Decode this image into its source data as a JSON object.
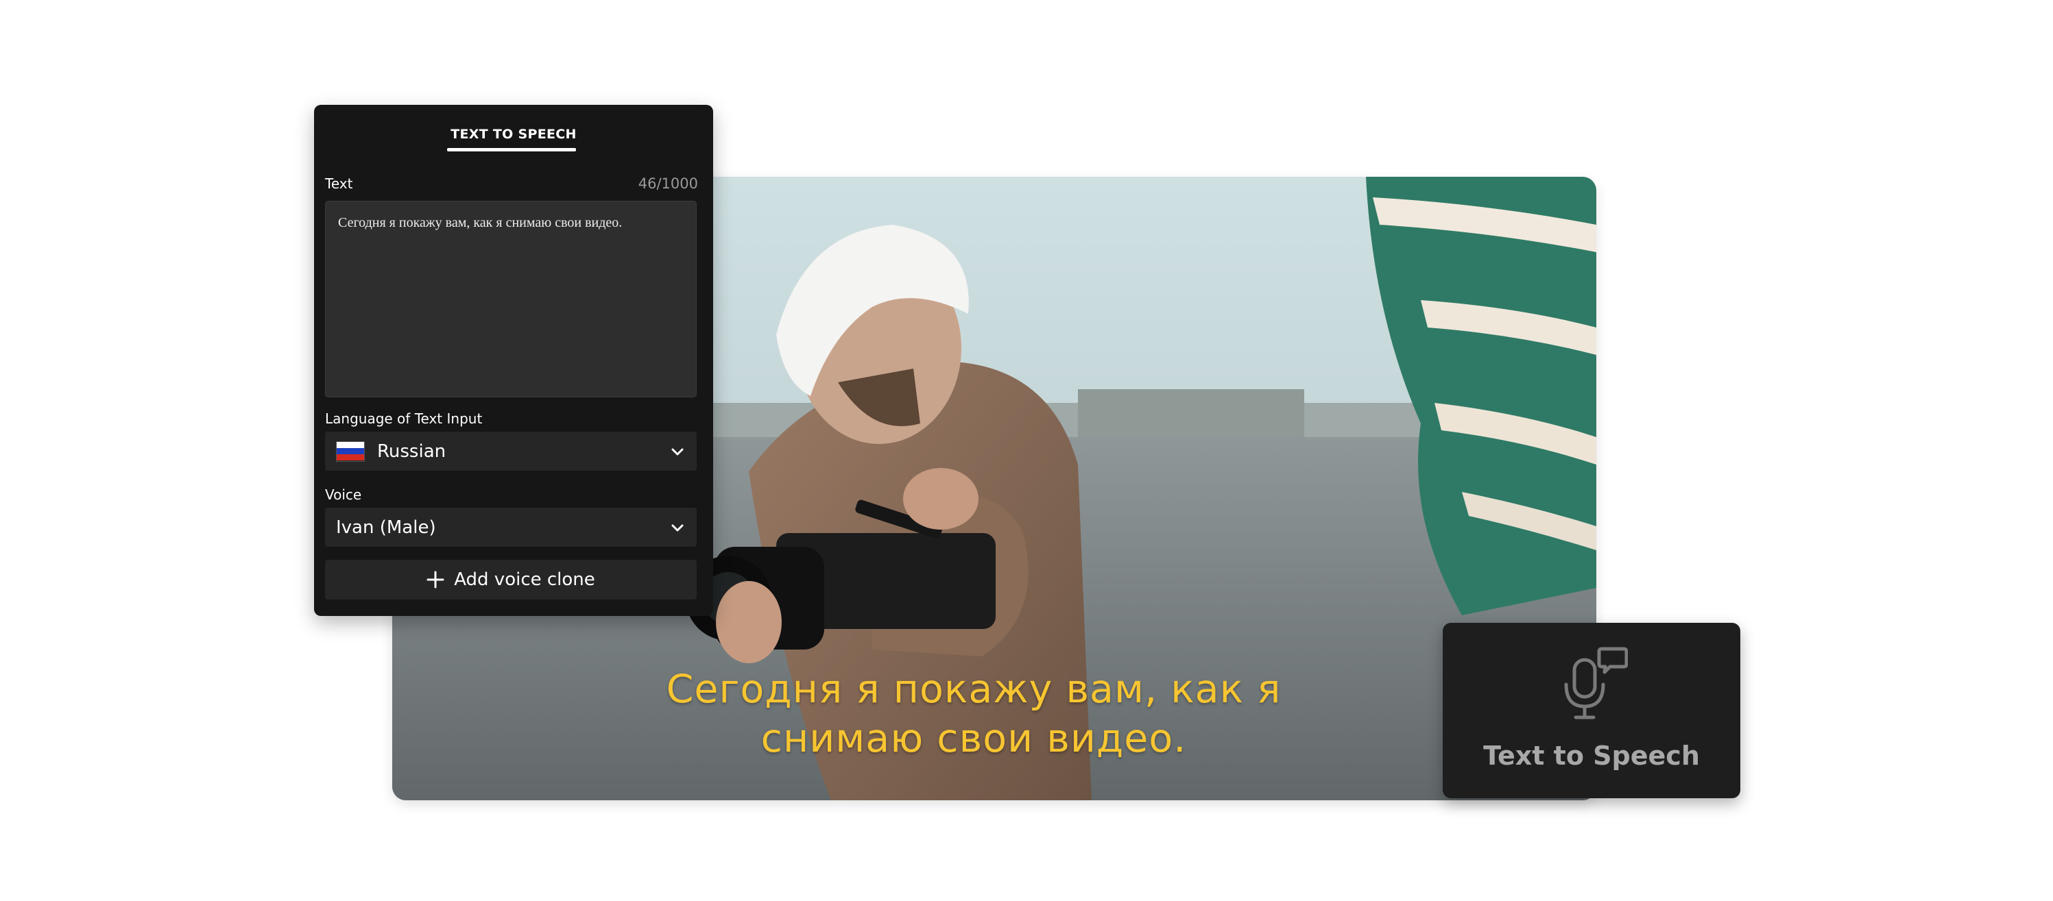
{
  "panel": {
    "tab_label": "TEXT TO SPEECH",
    "text_label": "Text",
    "char_count": "46/1000",
    "text_value": "Сегодня я покажу вам, как я снимаю свои видео.",
    "language_label": "Language of Text Input",
    "language_value": "Russian",
    "voice_label": "Voice",
    "voice_value": "Ivan (Male)",
    "add_voice_label": "Add voice clone"
  },
  "video": {
    "subtitle_line1": "Сегодня я покажу вам, как я",
    "subtitle_line2": "снимаю свои видео.",
    "subtitle_color": "#f7c531"
  },
  "feature_card": {
    "title": "Text to Speech",
    "icon": "microphone-speech-icon"
  },
  "colors": {
    "panel_bg": "#161616",
    "field_bg": "#2e2e2e",
    "flag_white": "#ffffff",
    "flag_blue": "#1d3fbf",
    "flag_red": "#d52b1e"
  },
  "icons": [
    "chevron-down-icon",
    "plus-icon",
    "microphone-speech-icon",
    "russia-flag-icon"
  ]
}
